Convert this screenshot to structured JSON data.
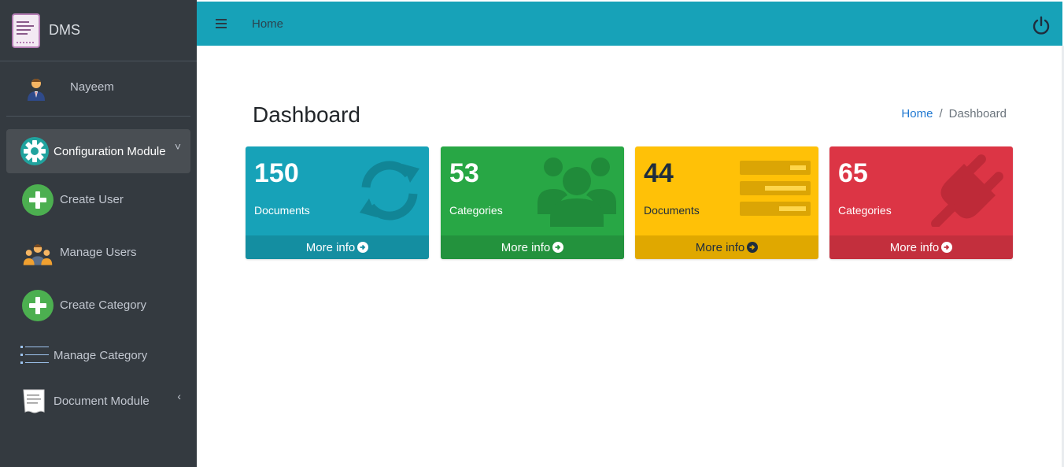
{
  "app": {
    "brand": "DMS"
  },
  "user": {
    "name": "Nayeem"
  },
  "nav": {
    "items": [
      {
        "label": "Configuration Module",
        "caret": "v"
      },
      {
        "label": "Create User"
      },
      {
        "label": "Manage Users"
      },
      {
        "label": "Create Category"
      },
      {
        "label": "Manage Category"
      },
      {
        "label": "Document Module",
        "caret": "<"
      }
    ]
  },
  "topbar": {
    "home": "Home"
  },
  "content": {
    "title": "Dashboard",
    "breadcrumb": {
      "home": "Home",
      "current": "Dashboard"
    }
  },
  "cards": [
    {
      "value": "150",
      "label": "Documents",
      "footer": "More info",
      "color": "#17a2b8",
      "footer_color": "#148ea1",
      "icon": "sync-icon"
    },
    {
      "value": "53",
      "label": "Categories",
      "footer": "More info",
      "color": "#28a745",
      "footer_color": "#23923d",
      "icon": "users-icon"
    },
    {
      "value": "44",
      "label": "Documents",
      "footer": "More info",
      "color": "#ffc107",
      "footer_color": "#e0a800",
      "icon": "list-icon"
    },
    {
      "value": "65",
      "label": "Categories",
      "footer": "More info",
      "color": "#dc3545",
      "footer_color": "#c32f3d",
      "icon": "plug-icon"
    }
  ]
}
